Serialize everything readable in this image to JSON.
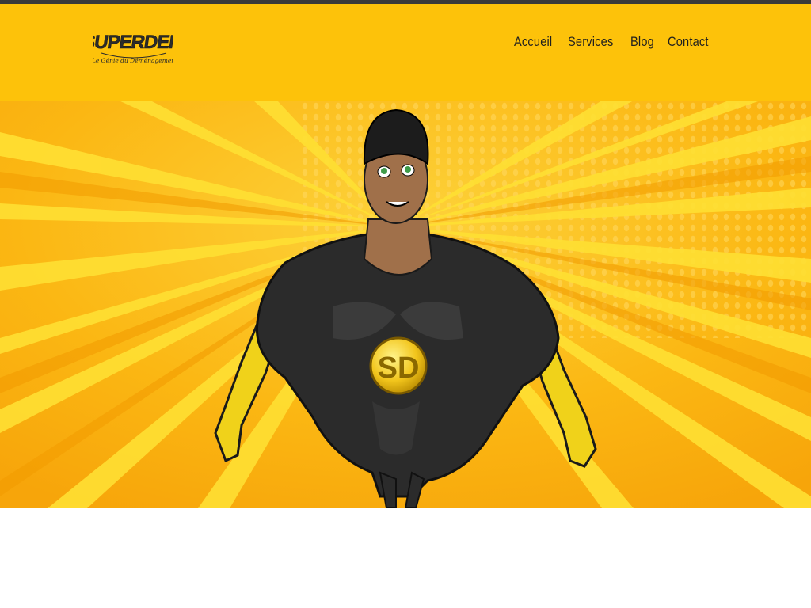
{
  "brand": {
    "name": "SUPERDEM",
    "tagline": "Le Génie du Déménagement",
    "emblem": "SD"
  },
  "nav": {
    "items": [
      {
        "label": "Accueil"
      },
      {
        "label": "Services"
      },
      {
        "label": "Blog"
      },
      {
        "label": "Contact"
      }
    ]
  },
  "colors": {
    "header_bg": "#fdc20a",
    "hero_bg": "#fbb713",
    "topbar": "#3a3a3a",
    "nav_text": "#1f1f1f"
  },
  "hero": {
    "image": "superhero-mascot-illustration"
  }
}
